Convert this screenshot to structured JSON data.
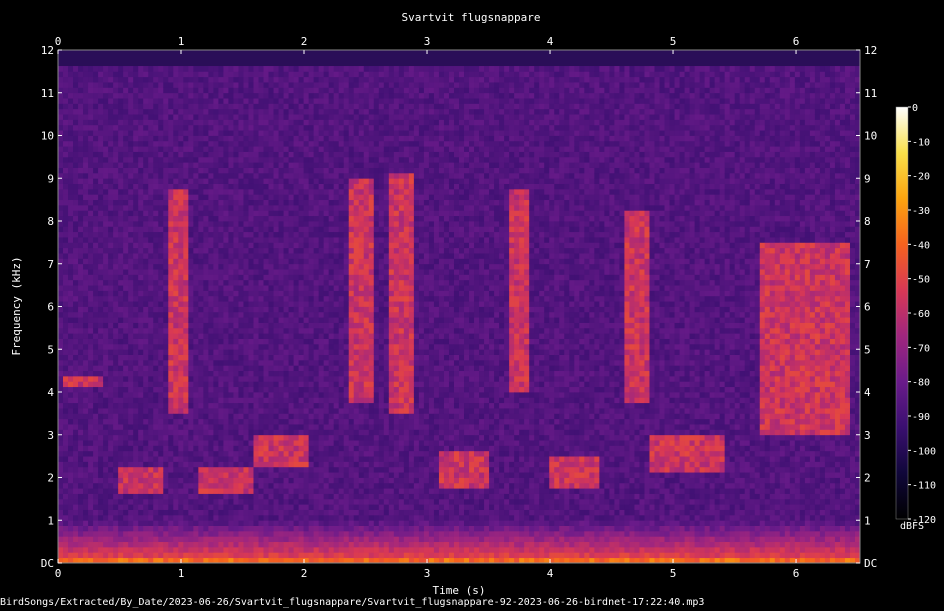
{
  "chart_data": {
    "type": "heatmap",
    "title": "Svartvit flugsnappare",
    "xlabel": "Time (s)",
    "ylabel": "Frequency (kHz)",
    "x_ticks": [
      "0",
      "1",
      "2",
      "3",
      "4",
      "5",
      "6"
    ],
    "x_tick_values": [
      0,
      1,
      2,
      3,
      4,
      5,
      6
    ],
    "y_ticks": [
      "DC",
      "1",
      "2",
      "3",
      "4",
      "5",
      "6",
      "7",
      "8",
      "9",
      "10",
      "11",
      "12"
    ],
    "y_tick_values": [
      0,
      1,
      2,
      3,
      4,
      5,
      6,
      7,
      8,
      9,
      10,
      11,
      12
    ],
    "xlim": [
      0,
      6.52
    ],
    "ylim": [
      0,
      12
    ],
    "colorbar": {
      "label": "dBFS",
      "ticks": [
        "0",
        "-10",
        "-20",
        "-30",
        "-40",
        "-50",
        "-60",
        "-70",
        "-80",
        "-90",
        "-100",
        "-110",
        "-120"
      ],
      "tick_values": [
        0,
        -10,
        -20,
        -30,
        -40,
        -50,
        -60,
        -70,
        -80,
        -90,
        -100,
        -110,
        -120
      ],
      "range": [
        -120,
        0
      ],
      "colormap": [
        "#000000",
        "#10073a",
        "#3a0f70",
        "#6a1b8a",
        "#a0267e",
        "#d83855",
        "#f5621e",
        "#fca40f",
        "#f9e04a",
        "#ffffff"
      ]
    },
    "dominant_events": [
      {
        "time_start": 0.05,
        "time_end": 0.35,
        "freq_low": 4.1,
        "freq_high": 4.4
      },
      {
        "time_start": 0.5,
        "time_end": 0.85,
        "freq_low": 1.6,
        "freq_high": 2.2
      },
      {
        "time_start": 0.9,
        "time_end": 1.05,
        "freq_low": 3.5,
        "freq_high": 8.8
      },
      {
        "time_start": 1.15,
        "time_end": 1.6,
        "freq_low": 1.6,
        "freq_high": 2.3
      },
      {
        "time_start": 1.6,
        "time_end": 2.05,
        "freq_low": 2.3,
        "freq_high": 3.0
      },
      {
        "time_start": 2.35,
        "time_end": 2.55,
        "freq_low": 3.8,
        "freq_high": 9.0
      },
      {
        "time_start": 2.7,
        "time_end": 2.9,
        "freq_low": 3.5,
        "freq_high": 9.1
      },
      {
        "time_start": 3.1,
        "time_end": 3.5,
        "freq_low": 1.8,
        "freq_high": 2.6
      },
      {
        "time_start": 3.65,
        "time_end": 3.85,
        "freq_low": 4.0,
        "freq_high": 8.8
      },
      {
        "time_start": 4.0,
        "time_end": 4.4,
        "freq_low": 1.7,
        "freq_high": 2.5
      },
      {
        "time_start": 4.6,
        "time_end": 4.8,
        "freq_low": 3.8,
        "freq_high": 8.2
      },
      {
        "time_start": 4.8,
        "time_end": 5.4,
        "freq_low": 2.1,
        "freq_high": 3.0
      },
      {
        "time_start": 5.7,
        "time_end": 6.45,
        "freq_low": 3.0,
        "freq_high": 7.5
      }
    ]
  },
  "footer": {
    "path": "BirdSongs/Extracted/By_Date/2023-06-26/Svartvit_flugsnappare/Svartvit_flugsnappare-92-2023-06-26-birdnet-17:22:40.mp3"
  }
}
